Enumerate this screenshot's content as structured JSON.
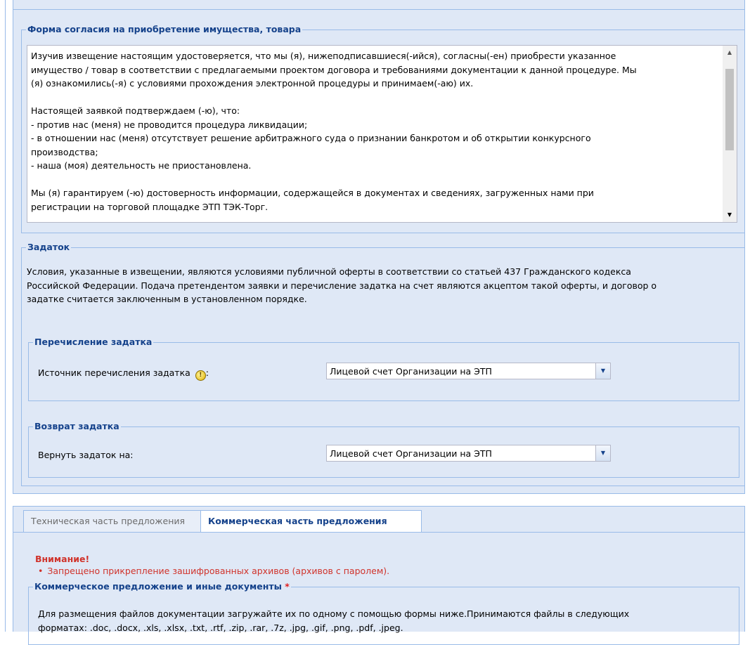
{
  "consent_section": {
    "legend": "Форма согласия на приобретение имущества, товара",
    "paragraphs": [
      "Изучив извещение настоящим удостоверяется, что мы (я), нижеподписавшиеся(-ийся), согласны(-ен) приобрести указанное",
      "имущество / товар в соответствии с предлагаемыми проектом договора и требованиями документации к данной процедуре. Мы",
      "(я) ознакомились(-я) с условиями прохождения электронной процедуры и принимаем(-аю) их.",
      "",
      "Настоящей заявкой подтверждаем (-ю), что:",
      "- против нас (меня) не проводится процедура ликвидации;",
      "- в отношении нас (меня) отсутствует решение арбитражного суда о признании банкротом и об открытии конкурсного",
      "производства;",
      "- наша (моя) деятельность не приостановлена.",
      "",
      "Мы (я) гарантируем (-ю) достоверность информации, содержащейся в документах и сведениях, загруженных нами при",
      "регистрации на торговой площадке ЭТП ТЭК-Торг."
    ]
  },
  "deposit_section": {
    "legend": "Задаток",
    "lines": [
      "Условия, указанные в извещении, являются условиями публичной оферты в соответствии со статьей 437 Гражданского кодекса",
      "Российской Федерации. Подача претендентом заявки и перечисление задатка на счет являются акцептом такой оферты, и договор о",
      "задатке считается заключенным в установленном порядке."
    ],
    "transfer": {
      "legend": "Перечисление задатка",
      "label": "Источник перечисления задатка",
      "colon": ":",
      "value": "Лицевой счет Организации на ЭТП"
    },
    "refund": {
      "legend": "Возврат задатка",
      "label": "Вернуть задаток на:",
      "value": "Лицевой счет Организации на ЭТП"
    }
  },
  "tabs": [
    {
      "label": "Техническая часть предложения",
      "active": false
    },
    {
      "label": "Коммерческая часть предложения",
      "active": true
    }
  ],
  "warning": {
    "title": "Внимание!",
    "items": [
      "Запрещено прикрепление зашифрованных архивов (архивов с паролем)."
    ]
  },
  "commercial_docs": {
    "legend": "Коммерческое предложение и иные документы",
    "required_mark": "*",
    "lines": [
      "Для размещения файлов документации загружайте их по одному с помощью формы ниже.Принимаются файлы в следующих",
      "форматах: .doc, .docx, .xls, .xlsx, .txt, .rtf, .zip, .rar, .7z, .jpg, .gif, .png, .pdf, .jpeg."
    ]
  },
  "colors": {
    "panel_bg": "#dfe8f6",
    "border": "#99bbe8",
    "legend_text": "#15428b",
    "warning_text": "#d0332b"
  }
}
